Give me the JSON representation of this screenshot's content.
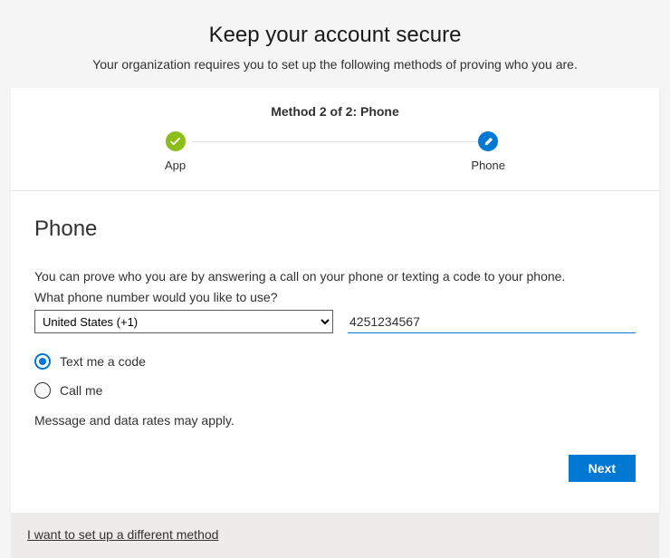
{
  "header": {
    "title": "Keep your account secure",
    "subtitle": "Your organization requires you to set up the following methods of proving who you are."
  },
  "progress": {
    "title": "Method 2 of 2: Phone",
    "steps": [
      {
        "label": "App",
        "state": "done",
        "icon": "checkmark"
      },
      {
        "label": "Phone",
        "state": "current",
        "icon": "pencil"
      }
    ]
  },
  "section": {
    "title": "Phone",
    "instruction": "You can prove who you are by answering a call on your phone or texting a code to your phone.",
    "question": "What phone number would you like to use?"
  },
  "country": {
    "selected": "United States (+1)"
  },
  "phone": {
    "value": "4251234567"
  },
  "methods": {
    "options": [
      {
        "label": "Text me a code",
        "selected": true
      },
      {
        "label": "Call me",
        "selected": false
      }
    ]
  },
  "fineprint": "Message and data rates may apply.",
  "actions": {
    "next": "Next"
  },
  "footer": {
    "alt_method": "I want to set up a different method"
  }
}
